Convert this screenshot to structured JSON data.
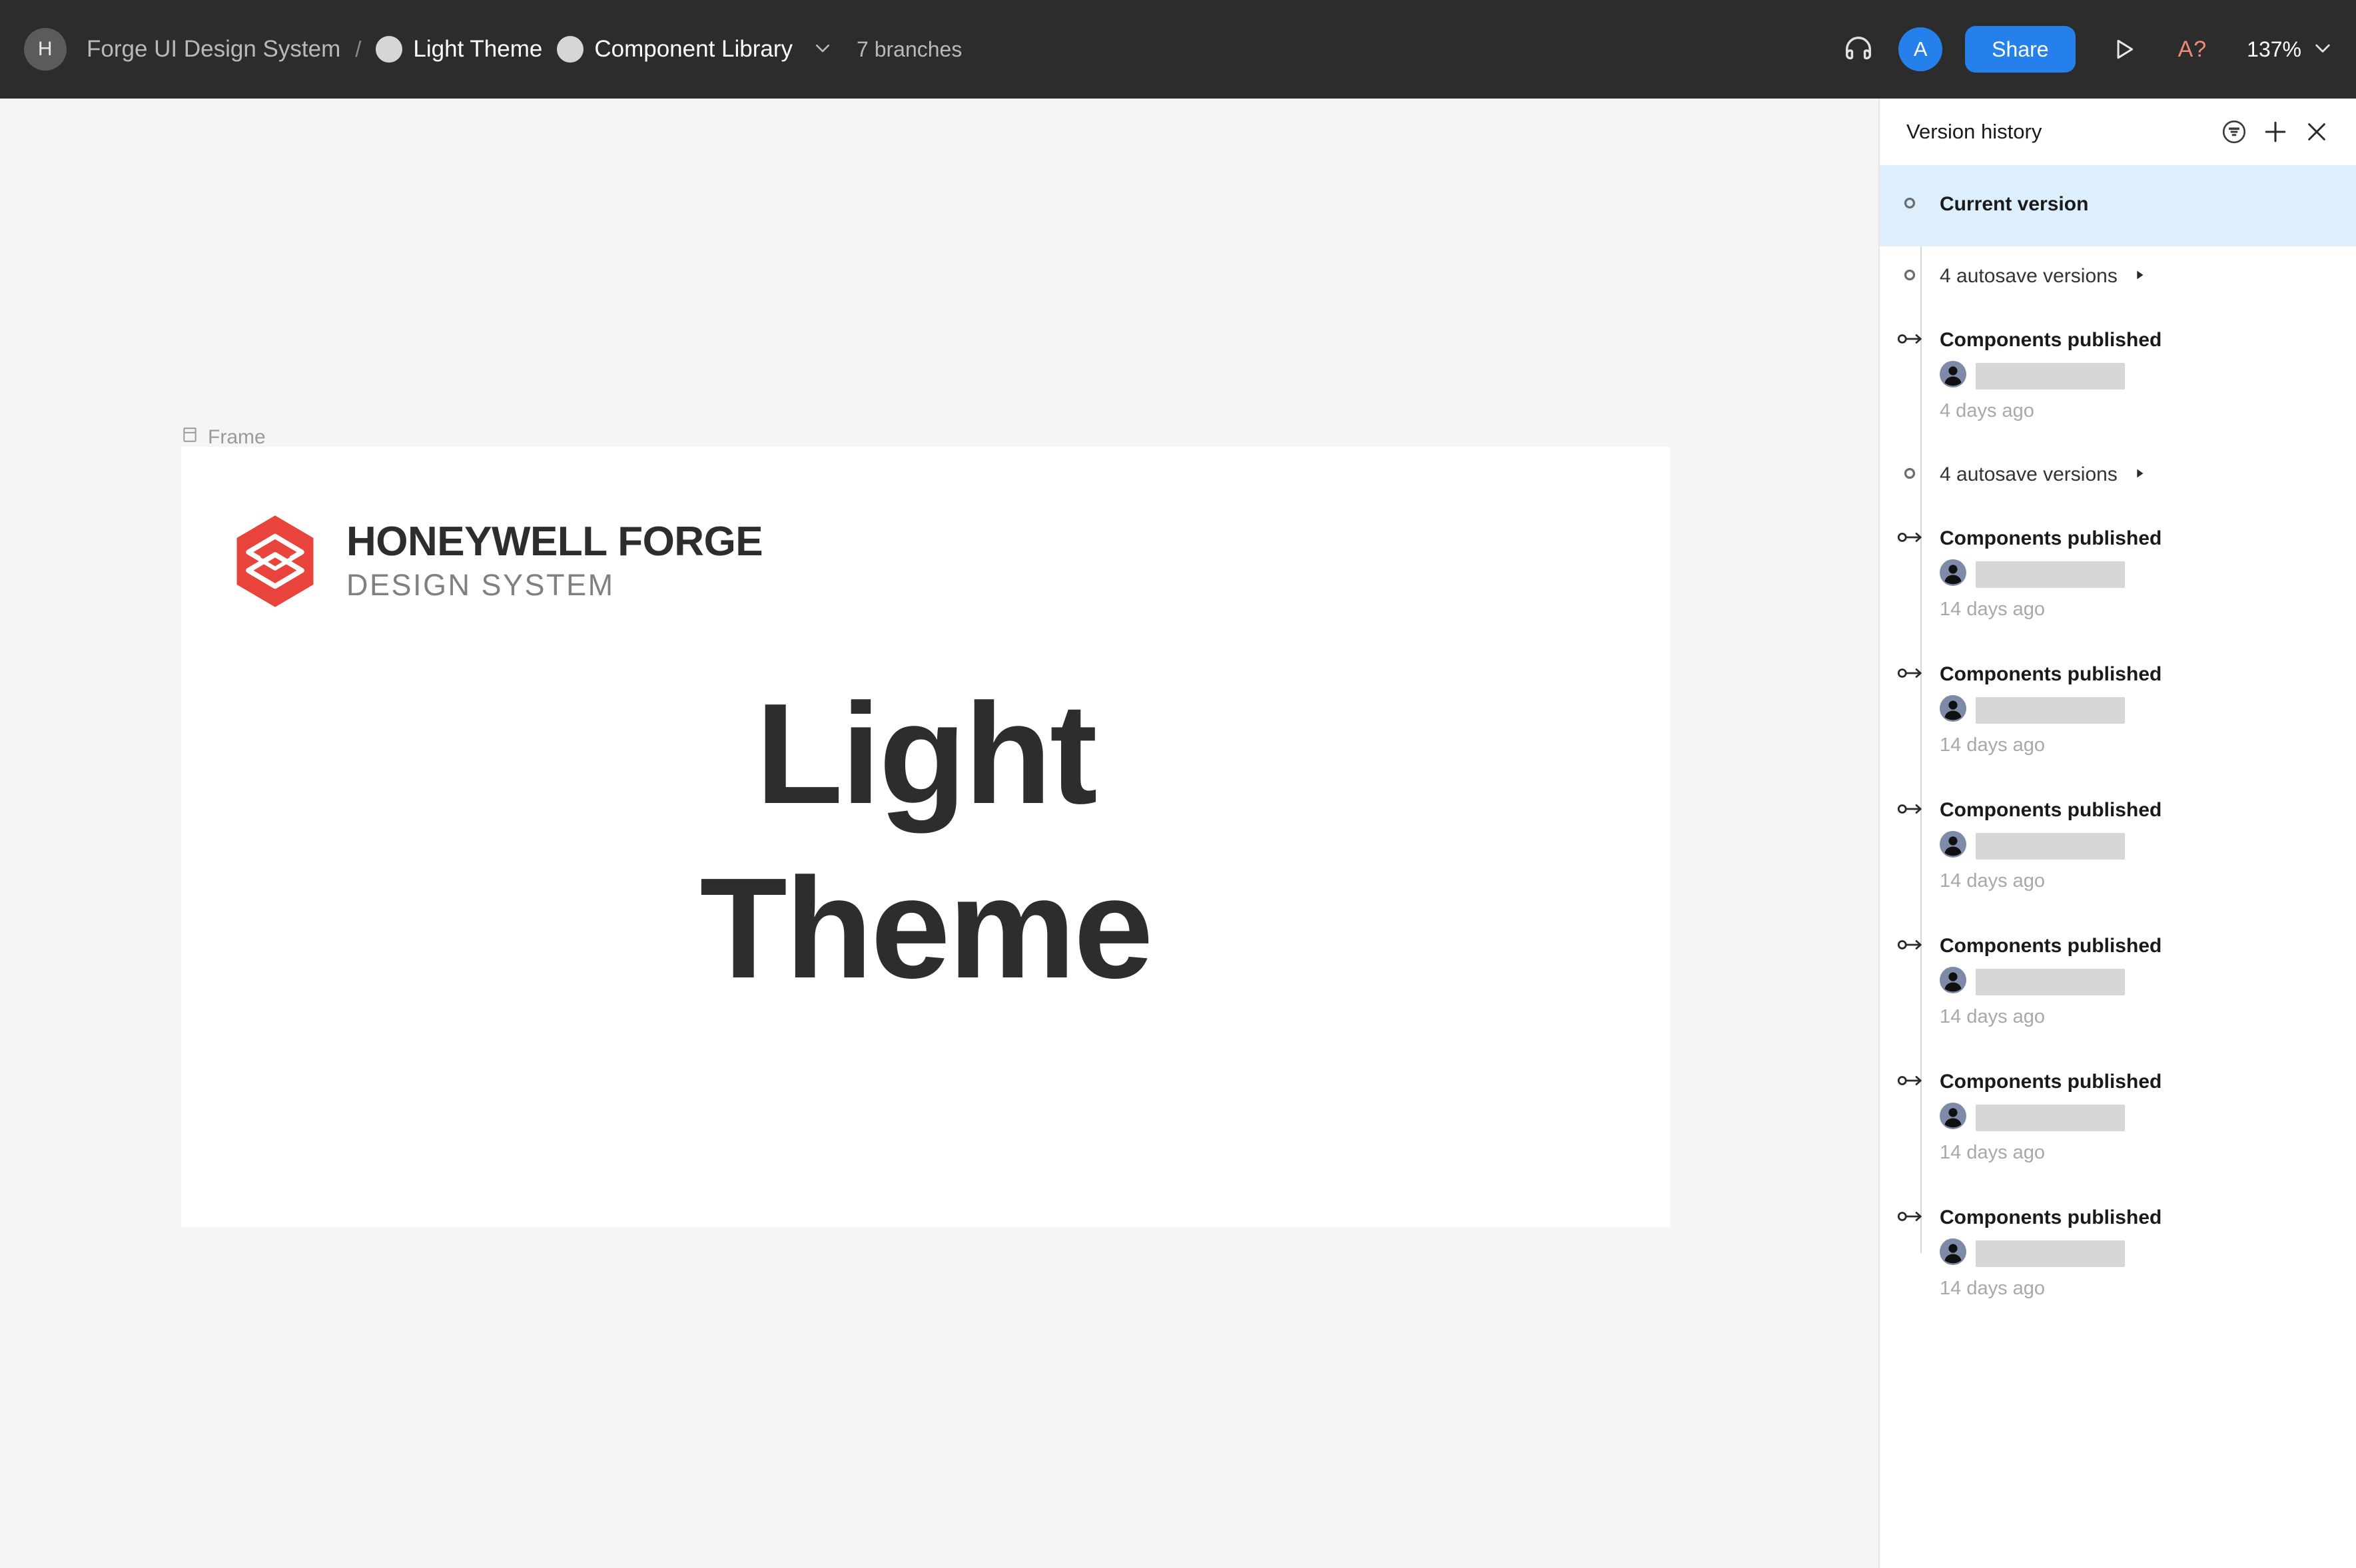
{
  "toolbar": {
    "home_initial": "H",
    "document_title": "Forge UI Design System",
    "separator": "/",
    "breadcrumbs": [
      {
        "label": "Light Theme"
      },
      {
        "label": "Component Library"
      }
    ],
    "branches_count": "7 branches",
    "headphones_icon": "headphones-icon",
    "avatar_initial": "A",
    "share_label": "Share",
    "present_icon": "play-icon",
    "accessibility_label": "A?",
    "zoom_level": "137%",
    "accent_blue": "#2680eb",
    "accent_coral": "#ef8a77",
    "bar_background": "#2c2c2c"
  },
  "canvas": {
    "background": "#f5f5f5",
    "frame_label": "Frame",
    "frame_background": "#ffffff",
    "logo": {
      "mark_color": "#e8443b",
      "title": "HONEYWELL FORGE",
      "subtitle": "DESIGN SYSTEM",
      "title_color": "#2d2d2d",
      "subtitle_color": "#808080"
    },
    "hero_line1": "Light",
    "hero_line2": "Theme",
    "hero_color": "#2d2d2d"
  },
  "panel": {
    "title": "Version history",
    "filter_icon": "filter-icon",
    "add_icon": "plus-icon",
    "close_icon": "close-icon",
    "highlight_color": "#ddeffc",
    "entries": [
      {
        "marker": "dot",
        "title": "Current version",
        "current": true,
        "has_author": false,
        "time": ""
      },
      {
        "marker": "dot",
        "title": "4 autosave versions",
        "expandable": true,
        "current": false,
        "has_author": false,
        "time": ""
      },
      {
        "marker": "publish",
        "title": "Components published",
        "current": false,
        "has_author": true,
        "time": "4 days ago"
      },
      {
        "marker": "dot",
        "title": "4 autosave versions",
        "expandable": true,
        "current": false,
        "has_author": false,
        "time": ""
      },
      {
        "marker": "publish",
        "title": "Components published",
        "current": false,
        "has_author": true,
        "time": "14 days ago"
      },
      {
        "marker": "publish",
        "title": "Components published",
        "current": false,
        "has_author": true,
        "time": "14 days ago"
      },
      {
        "marker": "publish",
        "title": "Components published",
        "current": false,
        "has_author": true,
        "time": "14 days ago"
      },
      {
        "marker": "publish",
        "title": "Components published",
        "current": false,
        "has_author": true,
        "time": "14 days ago"
      },
      {
        "marker": "publish",
        "title": "Components published",
        "current": false,
        "has_author": true,
        "time": "14 days ago"
      },
      {
        "marker": "publish",
        "title": "Components published",
        "current": false,
        "has_author": true,
        "time": "14 days ago"
      }
    ]
  }
}
